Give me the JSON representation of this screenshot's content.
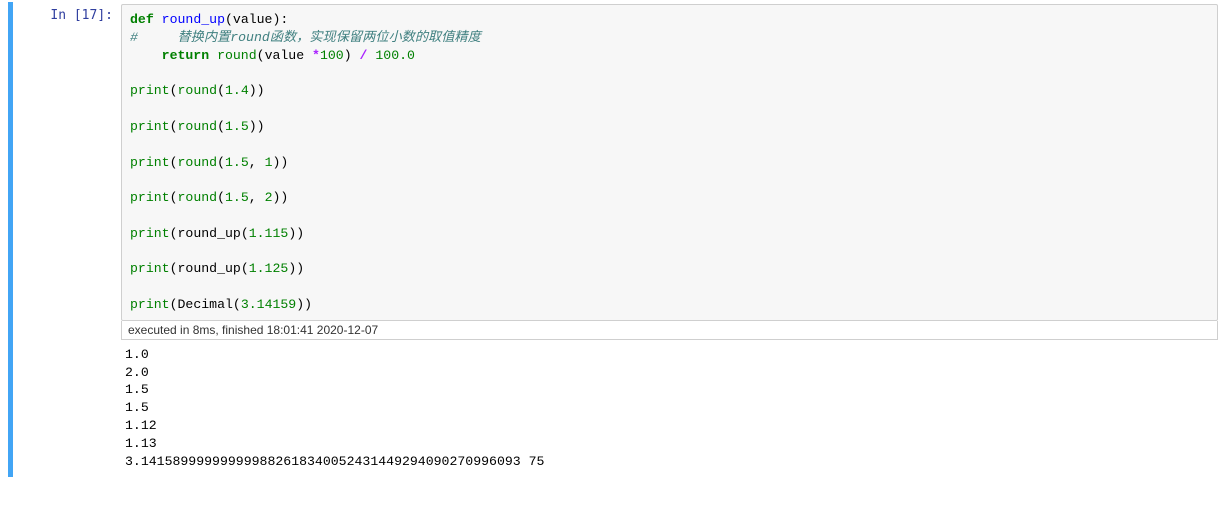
{
  "prompt": {
    "in_label": "In ",
    "exec_count": "[17]:"
  },
  "code": {
    "l1": {
      "kw": "def",
      "name": "round_up",
      "args": "value",
      "colon": ":"
    },
    "l2_comment": "#     替换内置round函数，实现保留两位小数的取值精度",
    "l3": {
      "kw": "return",
      "call": "round",
      "arg": "value ",
      "op1": "*",
      "n1": "100",
      "par": ") ",
      "op2": "/",
      "sp": " ",
      "n2": "100.0"
    },
    "l5": {
      "fn": "print",
      "call": "round",
      "n": "1.4"
    },
    "l7": {
      "fn": "print",
      "call": "round",
      "n": "1.5"
    },
    "l9": {
      "fn": "print",
      "call": "round",
      "n1": "1.5",
      "n2": "1"
    },
    "l11": {
      "fn": "print",
      "call": "round",
      "n1": "1.5",
      "n2": "2"
    },
    "l13": {
      "fn": "print",
      "call": "round_up",
      "n": "1.115"
    },
    "l15": {
      "fn": "print",
      "call": "round_up",
      "n": "1.125"
    },
    "l17": {
      "fn": "print",
      "call": "Decimal",
      "n": "3.14159"
    }
  },
  "timing": "executed in 8ms, finished 18:01:41 2020-12-07",
  "output_lines": [
    "1.0",
    "2.0",
    "1.5",
    "1.5",
    "1.12",
    "1.13",
    "3.141589999999999882618340052431449294090270996093 75"
  ]
}
